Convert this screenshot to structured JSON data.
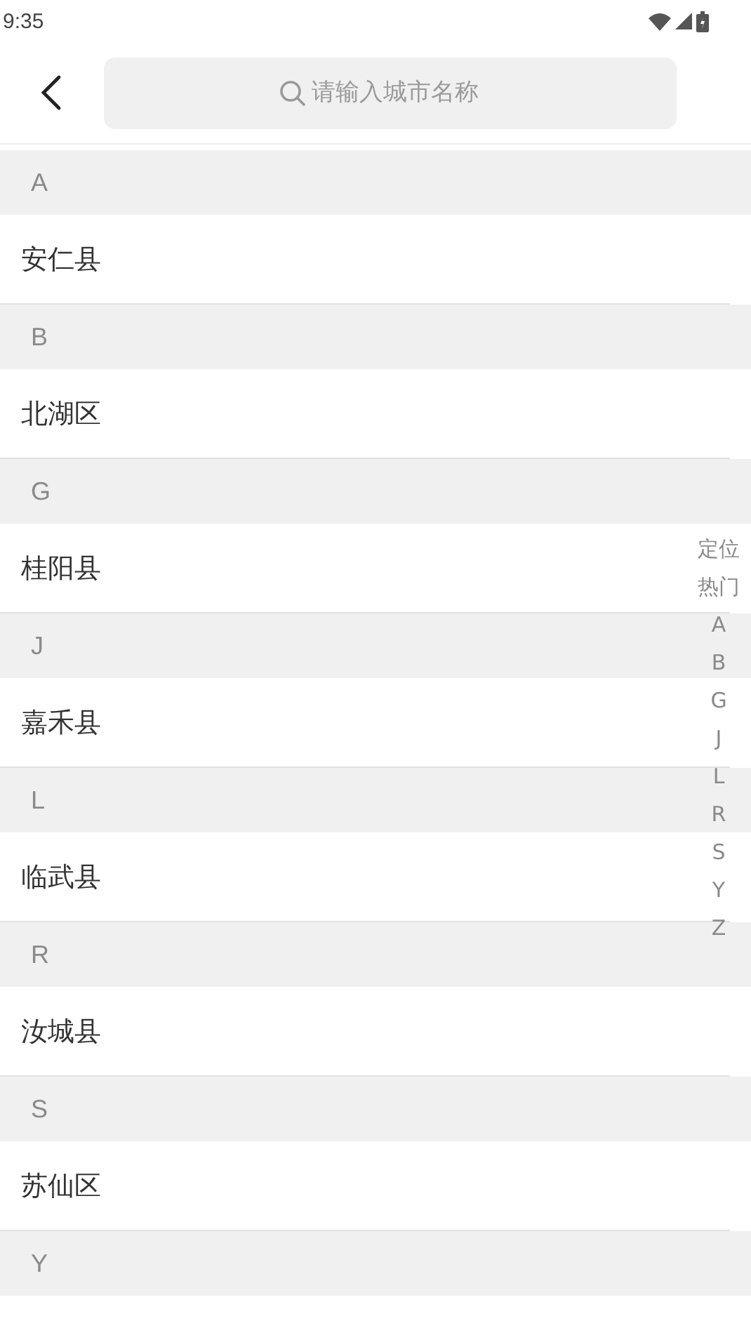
{
  "status_bar": {
    "time": "9:35"
  },
  "search": {
    "placeholder": "请输入城市名称"
  },
  "sections": [
    {
      "letter": "A",
      "cities": [
        "安仁县"
      ]
    },
    {
      "letter": "B",
      "cities": [
        "北湖区"
      ]
    },
    {
      "letter": "G",
      "cities": [
        "桂阳县"
      ]
    },
    {
      "letter": "J",
      "cities": [
        "嘉禾县"
      ]
    },
    {
      "letter": "L",
      "cities": [
        "临武县"
      ]
    },
    {
      "letter": "R",
      "cities": [
        "汝城县"
      ]
    },
    {
      "letter": "S",
      "cities": [
        "苏仙区"
      ]
    },
    {
      "letter": "Y"
    }
  ],
  "index_bar": [
    "定位",
    "热门",
    "A",
    "B",
    "G",
    "J",
    "L",
    "R",
    "S",
    "Y",
    "Z"
  ]
}
